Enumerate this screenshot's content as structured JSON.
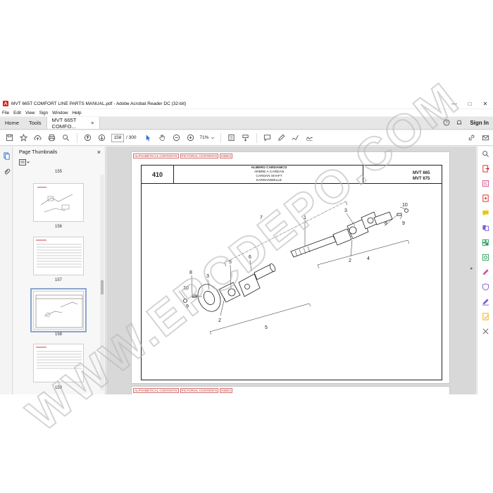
{
  "window": {
    "title": "MVT 665T COMFORT LINE PARTS MANUAL.pdf - Adobe Acrobat Reader DC (32-bit)",
    "minimize": "—",
    "maximize": "□",
    "close": "✕"
  },
  "menu": [
    "File",
    "Edit",
    "View",
    "Sign",
    "Window",
    "Help"
  ],
  "tabs": {
    "home": "Home",
    "tools": "Tools",
    "document": "MVT 665T COMFO...",
    "document_close": "×",
    "signin": "Sign In"
  },
  "toolbar": {
    "current_page": "158",
    "total_pages": "/ 300",
    "zoom": "71%"
  },
  "thumbnails": {
    "title": "Page Thumbnails",
    "close": "×",
    "labels": [
      "155",
      "156",
      "157",
      "158",
      "159"
    ]
  },
  "document": {
    "nav_links": [
      "ALPHABETICAL CONTENTS",
      "PICTORIAL CONTENTS",
      "INDEX"
    ],
    "page_number": "410",
    "part_names": [
      "ALBERO CARDANICO",
      "ARBRE A CARDAN",
      "CARDAN SHAFT",
      "KARDANWELLE"
    ],
    "models": [
      "MVT 665",
      "MVT 675"
    ],
    "callouts": {
      "left_assembly": [
        "10",
        "8",
        "9",
        "3",
        "5",
        "6",
        "2",
        "5"
      ],
      "right_assembly": [
        "7",
        "1",
        "3",
        "8",
        "10",
        "9",
        "2",
        "4"
      ]
    }
  },
  "watermark": "WWW.EPCDEPO.COM"
}
